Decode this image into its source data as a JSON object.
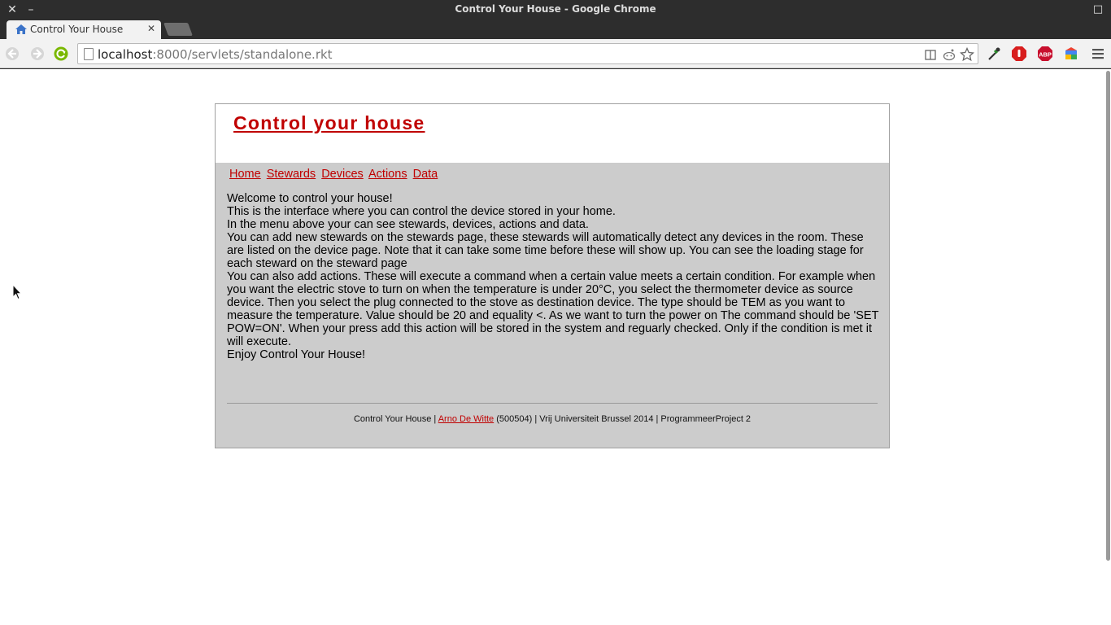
{
  "window": {
    "title": "Control Your House - Google Chrome",
    "close_glyph": "✕",
    "minimize_glyph": "–",
    "maximize_glyph": "□"
  },
  "tabs": [
    {
      "label": "Control Your House",
      "icon": "home-icon",
      "close_glyph": "✕"
    }
  ],
  "toolbar": {
    "url_host": "localhost",
    "url_rest": ":8000/servlets/standalone.rkt",
    "extensions": [
      "eyedropper-icon",
      "adblock-stop-icon",
      "abp-icon",
      "colorful-extension-icon"
    ]
  },
  "page": {
    "site_title": "Control your house",
    "menu": [
      "Home",
      "Stewards",
      "Devices",
      "Actions",
      "Data"
    ],
    "paragraphs": [
      "Welcome to control your house!",
      "This is the interface where you can control the device stored in your home.",
      "In the menu above your can see stewards, devices, actions and data.",
      "You can add new stewards on the stewards page, these stewards will automatically detect any devices in the room. These are listed on the device page. Note that it can take some time before these will show up. You can see the loading stage for each steward on the steward page",
      "You can also add actions. These will execute a command when a certain value meets a certain condition. For example when you want the electric stove to turn on when the temperature is under 20°C, you select the thermometer device as source device. Then you select the plug connected to the stove as destination device. The type should be TEM as you want to measure the temperature. Value should be 20 and equality <. As we want to turn the power on The command should be 'SET POW=ON'. When your press add this action will be stored in the system and reguarly checked. Only if the condition is met it will execute.",
      "Enjoy Control Your House!"
    ],
    "footer": {
      "prefix": "Control Your House | ",
      "author_link": "Arno De Witte",
      "suffix": " (500504) | Vrij Universiteit Brussel 2014 | ProgrammeerProject 2"
    }
  },
  "colors": {
    "accent_red": "#c00000",
    "content_bg": "#cccccc",
    "chrome_dark": "#2d2d2d"
  }
}
